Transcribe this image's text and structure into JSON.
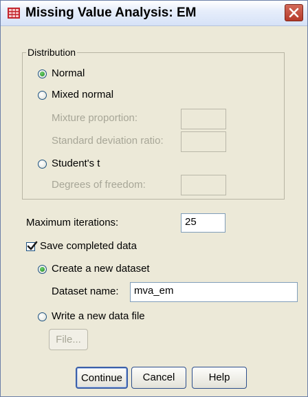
{
  "window": {
    "title": "Missing Value Analysis: EM"
  },
  "distribution": {
    "legend": "Distribution",
    "normal_label": "Normal",
    "mixed_normal_label": "Mixed normal",
    "mixture_proportion_label": "Mixture proportion:",
    "std_dev_ratio_label": "Standard deviation ratio:",
    "students_t_label": "Student's t",
    "degrees_of_freedom_label": "Degrees of freedom:",
    "selected": "Normal"
  },
  "iterations": {
    "label": "Maximum iterations:",
    "value": "25"
  },
  "save": {
    "label": "Save completed data",
    "checked": true,
    "create_dataset_label": "Create a new dataset",
    "dataset_name_label": "Dataset name:",
    "dataset_name_value": "mva_em",
    "write_file_label": "Write a new data file",
    "file_button_label": "File..."
  },
  "buttons": {
    "continue": "Continue",
    "cancel": "Cancel",
    "help": "Help"
  },
  "colors": {
    "radio_selected": "#2e9b2e",
    "disabled_text": "#a7a697",
    "dialog_background": "#ece9d8"
  }
}
